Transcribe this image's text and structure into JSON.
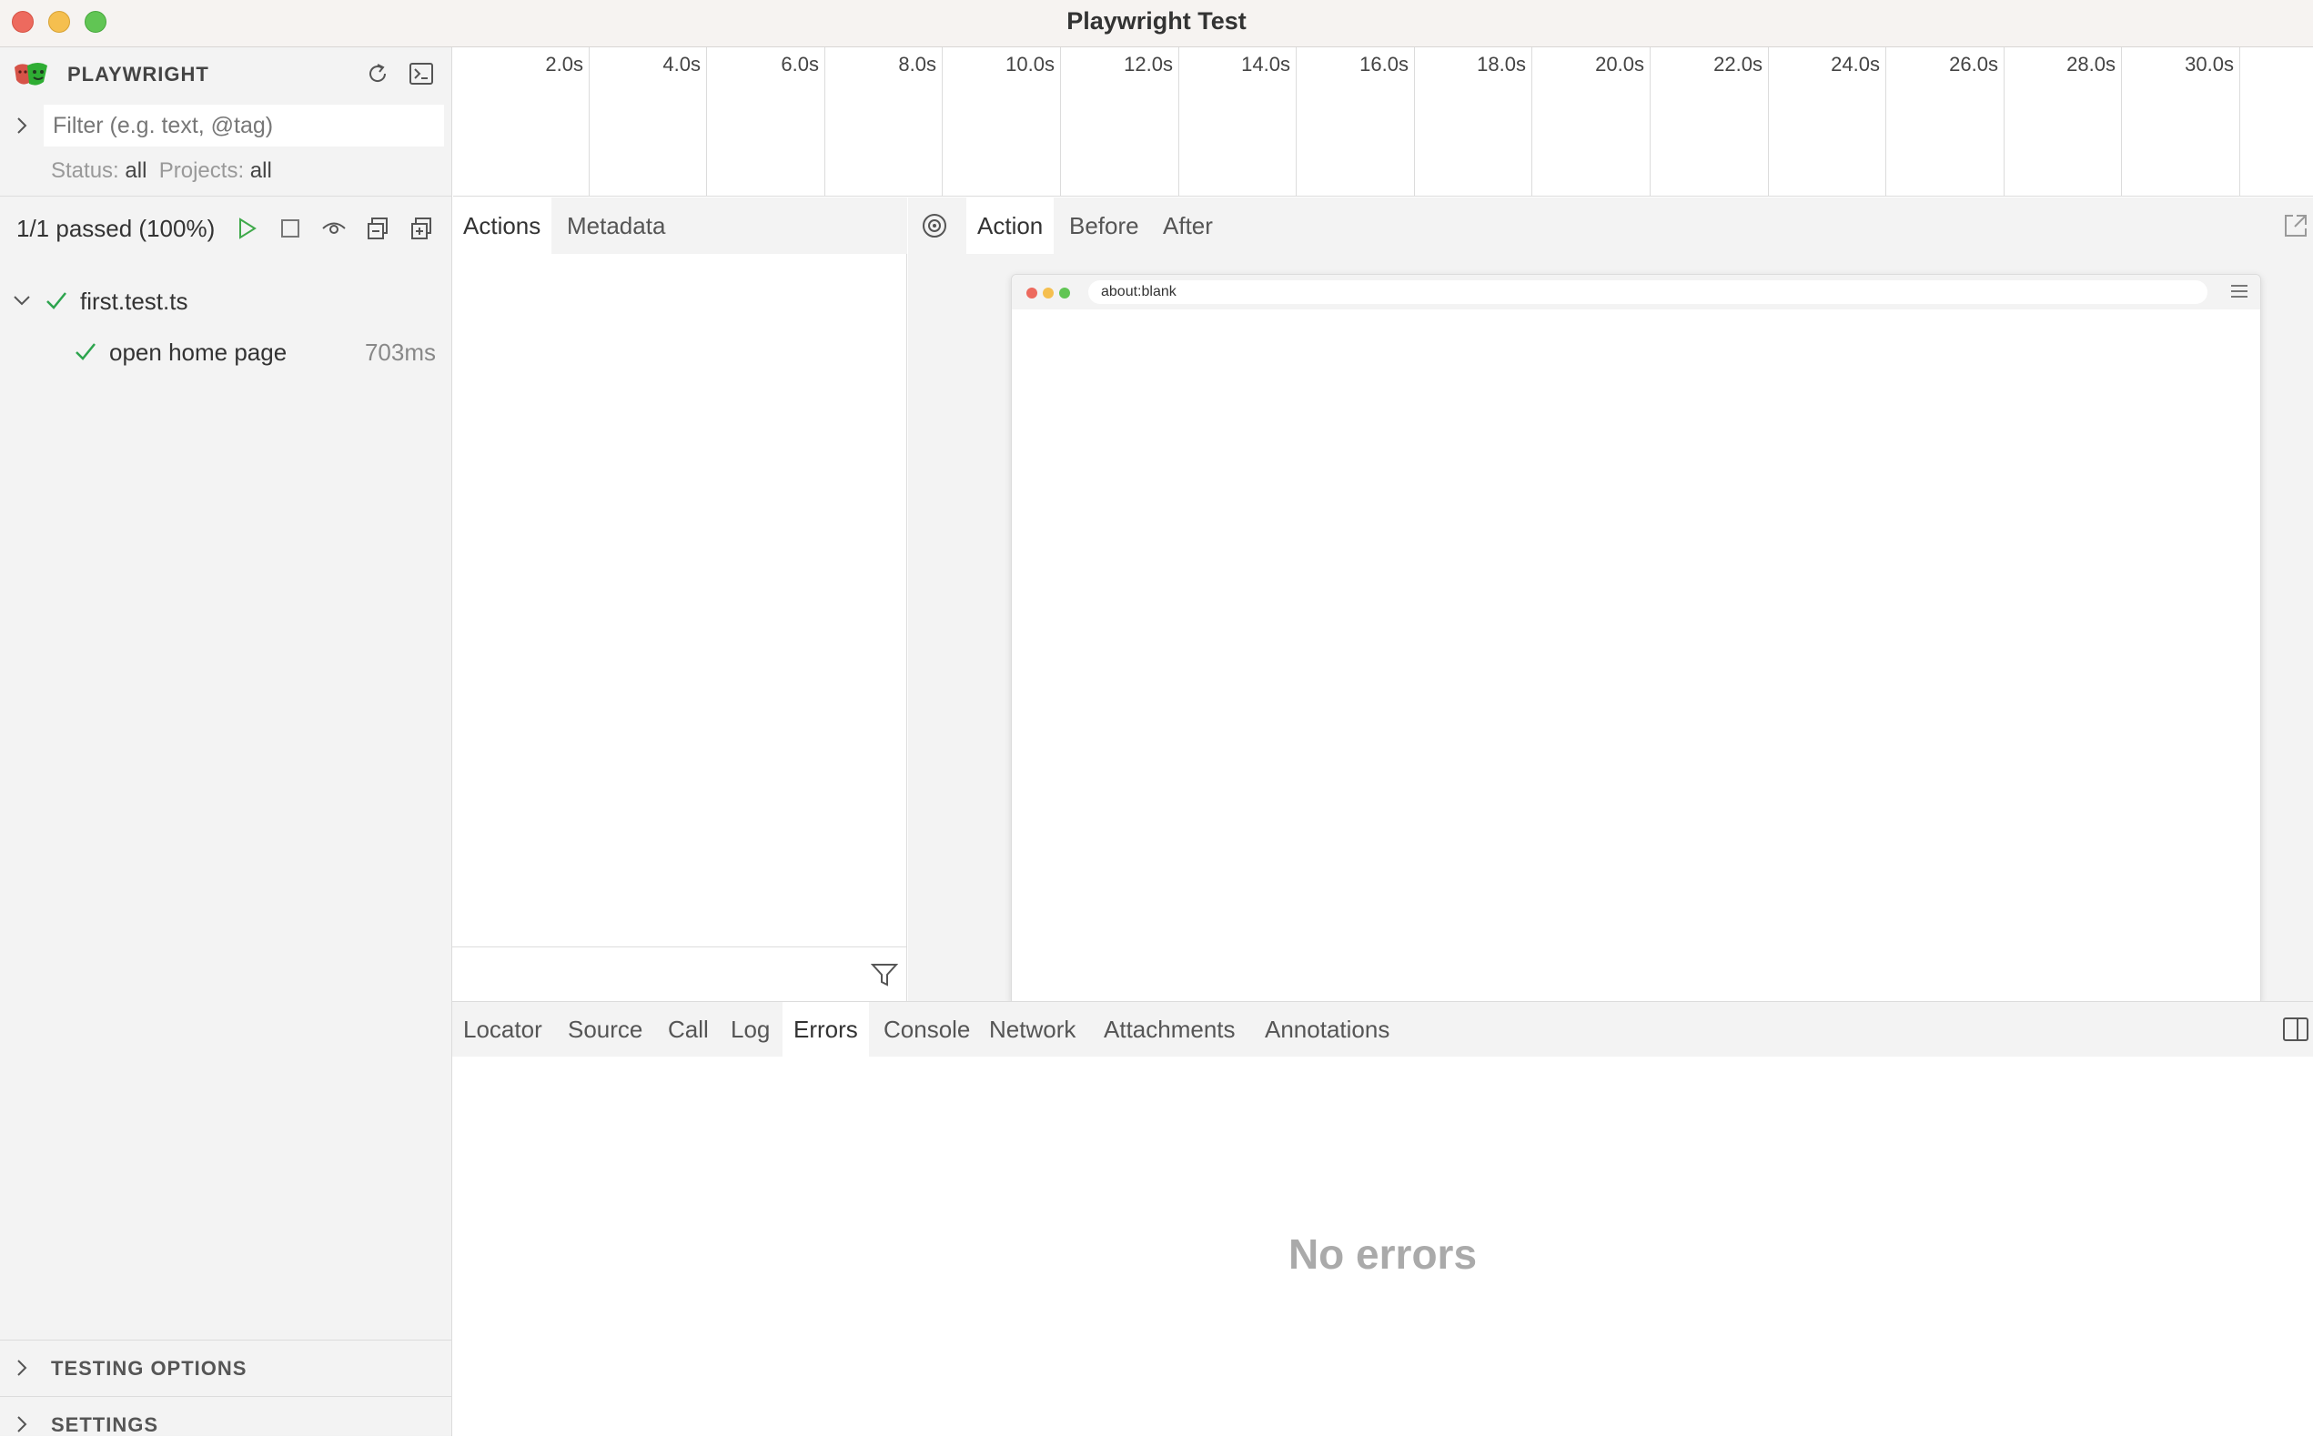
{
  "window": {
    "title": "Playwright Test"
  },
  "sidebar": {
    "brand": "PLAYWRIGHT",
    "filter": {
      "placeholder": "Filter (e.g. text, @tag)",
      "value": ""
    },
    "status_label": "Status:",
    "status_value": "all",
    "projects_label": "Projects:",
    "projects_value": "all",
    "summary": "1/1 passed (100%)",
    "tree": [
      {
        "label": "first.test.ts",
        "status": "passed",
        "expanded": true
      },
      {
        "label": "open home page",
        "status": "passed",
        "duration": "703ms"
      }
    ],
    "sections": [
      {
        "label": "TESTING OPTIONS"
      },
      {
        "label": "SETTINGS"
      }
    ]
  },
  "timeline": {
    "ticks": [
      "2.0s",
      "4.0s",
      "6.0s",
      "8.0s",
      "10.0s",
      "12.0s",
      "14.0s",
      "16.0s",
      "18.0s",
      "20.0s",
      "22.0s",
      "24.0s",
      "26.0s",
      "28.0s",
      "30.0s",
      "3"
    ]
  },
  "actions_panel": {
    "tabs": [
      "Actions",
      "Metadata"
    ],
    "active_tab": "Actions"
  },
  "snapshot_panel": {
    "tabs": [
      "Action",
      "Before",
      "After"
    ],
    "active_tab": "Action",
    "browser_url": "about:blank"
  },
  "bottom_panel": {
    "tabs": [
      "Locator",
      "Source",
      "Call",
      "Log",
      "Errors",
      "Console",
      "Network",
      "Attachments",
      "Annotations"
    ],
    "active_tab": "Errors",
    "empty_message": "No errors"
  },
  "colors": {
    "pass_green": "#2da44e",
    "play_green": "#3fa94a",
    "panel_bg": "#f3f3f3",
    "border": "#dcdcdc"
  },
  "icons": {
    "logo": "playwright-logo",
    "reload": "reload-icon",
    "terminal": "terminal-icon",
    "filter_expand": "chevron-right-icon",
    "run": "play-icon",
    "stop": "stop-icon",
    "watch": "eye-icon",
    "collapse_all": "collapse-all-icon",
    "expand_all": "expand-all-icon",
    "pick_locator": "target-icon",
    "open_external": "open-external-icon",
    "filter_actions": "funnel-icon",
    "dock_toggle": "sidebar-toggle-icon"
  }
}
